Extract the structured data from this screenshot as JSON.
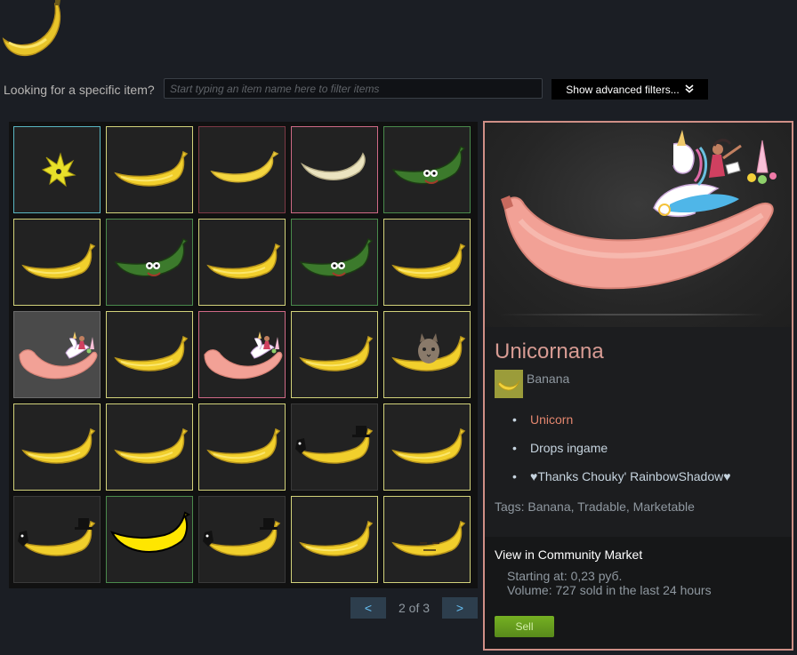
{
  "header": {
    "logo_icon": "banana-logo-icon"
  },
  "filter": {
    "label": "Looking for a specific item?",
    "placeholder": "Start typing an item name here to filter items",
    "value": "",
    "advanced_label": "Show advanced filters...",
    "advanced_icon": "double-chevron-down-icon"
  },
  "inventory": {
    "rows": [
      [
        {
          "kind": "spiky",
          "rarity": "cyan"
        },
        {
          "kind": "banana",
          "rarity": "yellow"
        },
        {
          "kind": "peeled",
          "rarity": "maroon"
        },
        {
          "kind": "pale",
          "rarity": "pink"
        },
        {
          "kind": "pepe",
          "rarity": "green"
        }
      ],
      [
        {
          "kind": "banana",
          "rarity": "yellow"
        },
        {
          "kind": "pepe",
          "rarity": "green"
        },
        {
          "kind": "banana",
          "rarity": "yellow"
        },
        {
          "kind": "pepe",
          "rarity": "green"
        },
        {
          "kind": "banana",
          "rarity": "yellow"
        }
      ],
      [
        {
          "kind": "unicorn",
          "rarity": "dark",
          "selected": true
        },
        {
          "kind": "banana",
          "rarity": "yellow"
        },
        {
          "kind": "unicorn",
          "rarity": "pink"
        },
        {
          "kind": "banana",
          "rarity": "yellow"
        },
        {
          "kind": "cat",
          "rarity": "yellow"
        }
      ],
      [
        {
          "kind": "banana",
          "rarity": "yellow"
        },
        {
          "kind": "banana",
          "rarity": "yellow"
        },
        {
          "kind": "banana",
          "rarity": "yellow"
        },
        {
          "kind": "tophat",
          "rarity": "dark"
        },
        {
          "kind": "banana",
          "rarity": "yellow"
        }
      ],
      [
        {
          "kind": "tophat",
          "rarity": "dark"
        },
        {
          "kind": "cartoon",
          "rarity": "green"
        },
        {
          "kind": "tophat",
          "rarity": "dark"
        },
        {
          "kind": "banana",
          "rarity": "yellow"
        },
        {
          "kind": "face",
          "rarity": "yellow"
        }
      ]
    ]
  },
  "pager": {
    "prev_label": "<",
    "next_label": ">",
    "text": "2 of 3"
  },
  "details": {
    "name": "Unicornana",
    "game_name": "Banana",
    "descriptions": [
      {
        "text": "Unicorn",
        "accent": true
      },
      {
        "text": "Drops ingame",
        "accent": false
      },
      {
        "text": "♥Thanks Chouky' RainbowShadow♥",
        "accent": false
      }
    ],
    "tags_label": "Tags:",
    "tags_value": "Banana, Tradable, Marketable",
    "market_title": "View in Community Market",
    "starting_at": "Starting at: 0,23 руб.",
    "volume": "Volume: 727 sold in the last 24 hours",
    "sell_label": "Sell"
  },
  "colors": {
    "accent_name": "#d79b93",
    "panel_border": "#cf8f86",
    "sell_green": "#75b022",
    "unicorn_desc": "#e3866e"
  }
}
